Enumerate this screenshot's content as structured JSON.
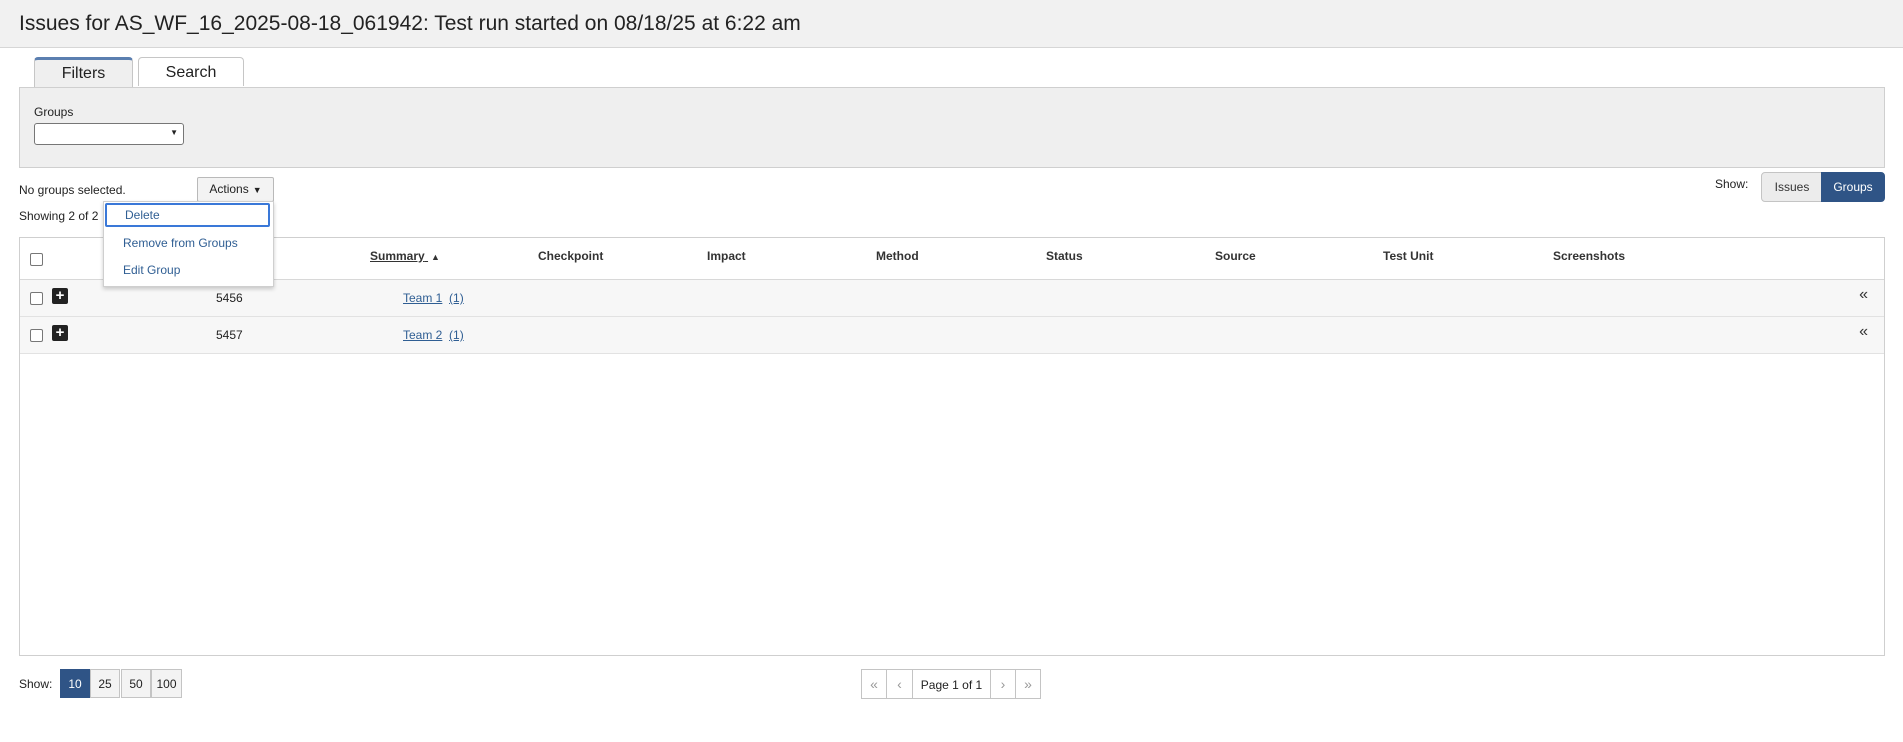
{
  "header": {
    "title": "Issues for AS_WF_16_2025-08-18_061942: Test run started on 08/18/25 at 6:22 am"
  },
  "tabs": [
    {
      "label": "Filters",
      "active": true
    },
    {
      "label": "Search",
      "active": false
    }
  ],
  "filters": {
    "groups_label": "Groups",
    "groups_value": ""
  },
  "selection_status": "No groups selected.",
  "showing_text": "Showing 2 of 2",
  "actions": {
    "label": "Actions",
    "menu": [
      {
        "label": "Delete"
      },
      {
        "label": "Remove from Groups"
      },
      {
        "label": "Edit Group"
      }
    ]
  },
  "view_toggle": {
    "label": "Show:",
    "options": [
      "Issues",
      "Groups"
    ],
    "selected": "Groups"
  },
  "table": {
    "columns": [
      "Summary",
      "Checkpoint",
      "Impact",
      "Method",
      "Status",
      "Source",
      "Test Unit",
      "Screenshots"
    ],
    "sorted_column": "Summary",
    "rows": [
      {
        "id": "5456",
        "summary": "Team 1",
        "count": "(1)"
      },
      {
        "id": "5457",
        "summary": "Team 2",
        "count": "(1)"
      }
    ]
  },
  "pagination": {
    "show_label": "Show:",
    "page_sizes": [
      "10",
      "25",
      "50",
      "100"
    ],
    "selected_size": "10",
    "page_label": "Page 1 of 1"
  },
  "icons": {
    "expand": "plus-square-icon",
    "collapse": "double-chevron-left-icon",
    "first": "double-chevron-left-icon",
    "prev": "chevron-left-icon",
    "next": "chevron-right-icon",
    "last": "double-chevron-right-icon"
  },
  "colors": {
    "accent": "#2f5486",
    "link": "#2f5e93",
    "focus": "#3a78d8"
  }
}
